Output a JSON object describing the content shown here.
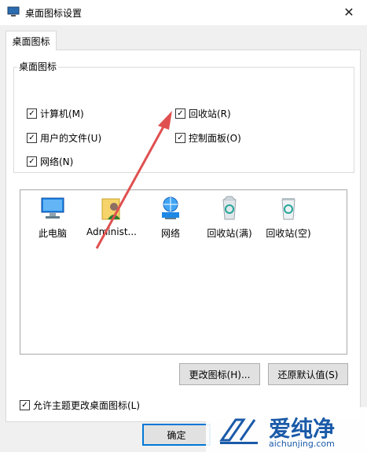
{
  "window": {
    "title": "桌面图标设置",
    "close_glyph": "✕"
  },
  "tabs": [
    {
      "label": "桌面图标",
      "active": true
    }
  ],
  "group": {
    "title": "桌面图标",
    "checkboxes": [
      {
        "label": "计算机(M)",
        "checked": true
      },
      {
        "label": "回收站(R)",
        "checked": true
      },
      {
        "label": "用户的文件(U)",
        "checked": true
      },
      {
        "label": "控制面板(O)",
        "checked": true
      },
      {
        "label": "网络(N)",
        "checked": true
      }
    ]
  },
  "icons": [
    {
      "label": "此电脑",
      "icon": "computer-icon"
    },
    {
      "label": "Administ...",
      "icon": "user-folder-icon"
    },
    {
      "label": "网络",
      "icon": "network-icon"
    },
    {
      "label": "回收站(满)",
      "icon": "recycle-bin-full-icon"
    },
    {
      "label": "回收站(空)",
      "icon": "recycle-bin-empty-icon"
    }
  ],
  "buttons": {
    "change_icon": "更改图标(H)...",
    "restore_default": "还原默认值(S)",
    "ok": "确定"
  },
  "theme_checkbox": {
    "label": "允许主题更改桌面图标(L)",
    "checked": true
  },
  "watermark": {
    "name": "爱纯净",
    "url": "aichunjing.com"
  },
  "colors": {
    "accent": "#0078d7",
    "arrow": "#e05050",
    "watermark": "#1a5aa8"
  }
}
